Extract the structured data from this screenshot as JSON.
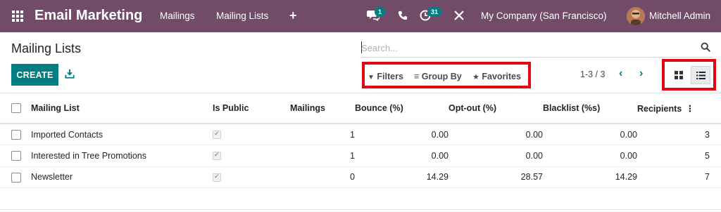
{
  "navbar": {
    "app_title": "Email Marketing",
    "menu": [
      "Mailings",
      "Mailing Lists"
    ],
    "plus": "+",
    "messages_badge": "1",
    "activities_badge": "31",
    "company": "My Company (San Francisco)",
    "user": "Mitchell Admin",
    "color": "#714b67"
  },
  "control_panel": {
    "title": "Mailing Lists",
    "search_placeholder": "Search...",
    "create_label": "CREATE",
    "filters": {
      "filters_label": "Filters",
      "group_by_label": "Group By",
      "favorites_label": "Favorites"
    },
    "pager": "1-3 / 3",
    "active_view": "list",
    "accent": "#017e84",
    "highlight": "#e20613"
  },
  "table": {
    "columns": [
      "Mailing List",
      "Is Public",
      "Mailings",
      "Bounce (%)",
      "Opt-out (%)",
      "Blacklist (%s)",
      "Recipients"
    ],
    "rows": [
      {
        "name": "Imported Contacts",
        "is_public": true,
        "mailings": "1",
        "bounce": "0.00",
        "optout": "0.00",
        "blacklist": "0.00",
        "recipients": "3"
      },
      {
        "name": "Interested in Tree Promotions",
        "is_public": true,
        "mailings": "1",
        "bounce": "0.00",
        "optout": "0.00",
        "blacklist": "0.00",
        "recipients": "5"
      },
      {
        "name": "Newsletter",
        "is_public": true,
        "mailings": "0",
        "bounce": "14.29",
        "optout": "28.57",
        "blacklist": "14.29",
        "recipients": "7"
      }
    ]
  }
}
